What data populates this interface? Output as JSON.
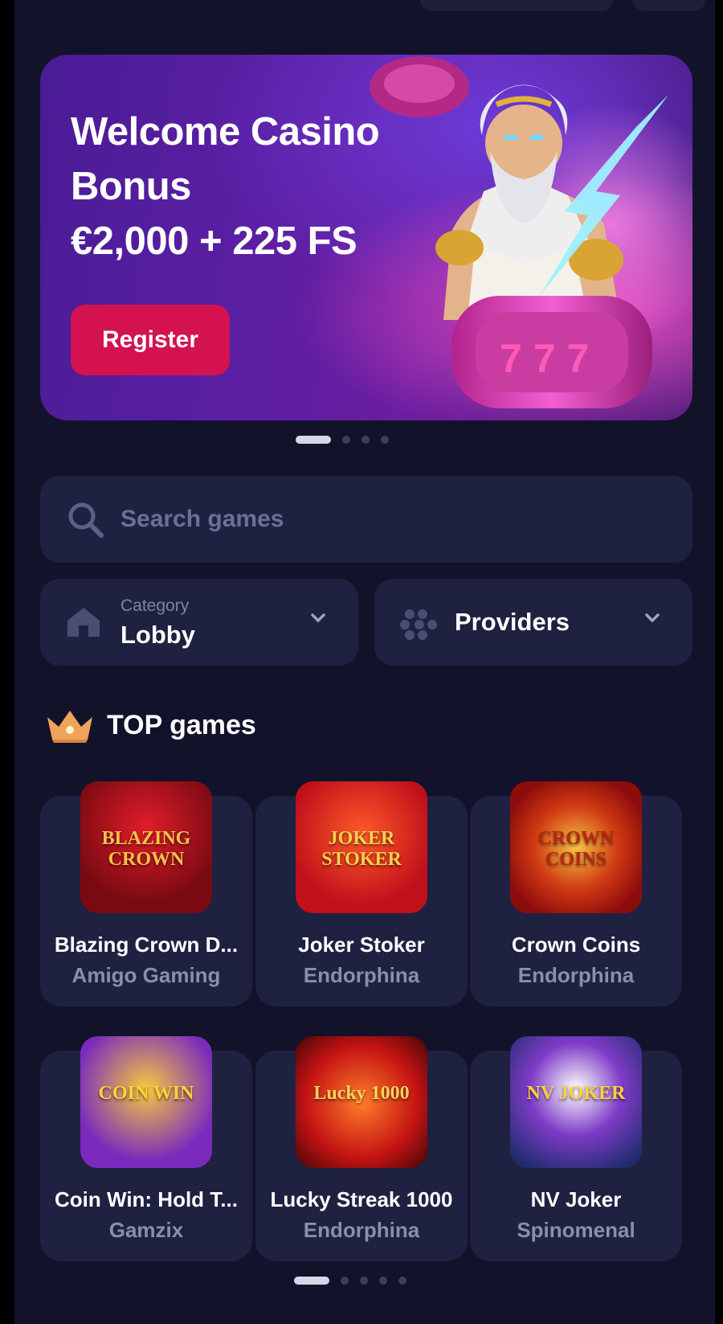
{
  "banner": {
    "title_line1": "Welcome Casino",
    "title_line2": "Bonus",
    "title_line3": "€2,000 + 225 FS",
    "register_label": "Register",
    "slides": 4,
    "active_slide": 1
  },
  "search": {
    "placeholder": "Search games",
    "value": ""
  },
  "filters": {
    "category": {
      "caption": "Category",
      "value": "Lobby"
    },
    "providers": {
      "value": "Providers"
    }
  },
  "top_games": {
    "title": "TOP games",
    "games": [
      {
        "name": "Blazing Crown D...",
        "provider": "Amigo Gaming",
        "art_text": "BLAZING CROWN"
      },
      {
        "name": "Joker Stoker",
        "provider": "Endorphina",
        "art_text": "JOKER STOKER"
      },
      {
        "name": "Crown Coins",
        "provider": "Endorphina",
        "art_text": "CROWN COINS"
      },
      {
        "name": "Coin Win: Hold T...",
        "provider": "Gamzix",
        "art_text": "COIN WIN"
      },
      {
        "name": "Lucky Streak 1000",
        "provider": "Endorphina",
        "art_text": "Lucky 1000"
      },
      {
        "name": "NV Joker",
        "provider": "Spinomenal",
        "art_text": "NV JOKER"
      }
    ],
    "pages": 5,
    "active_page": 1
  },
  "colors": {
    "background": "#12132a",
    "panel": "#1f2140",
    "accent": "#d3124f",
    "muted_text": "#8c8fa8"
  }
}
